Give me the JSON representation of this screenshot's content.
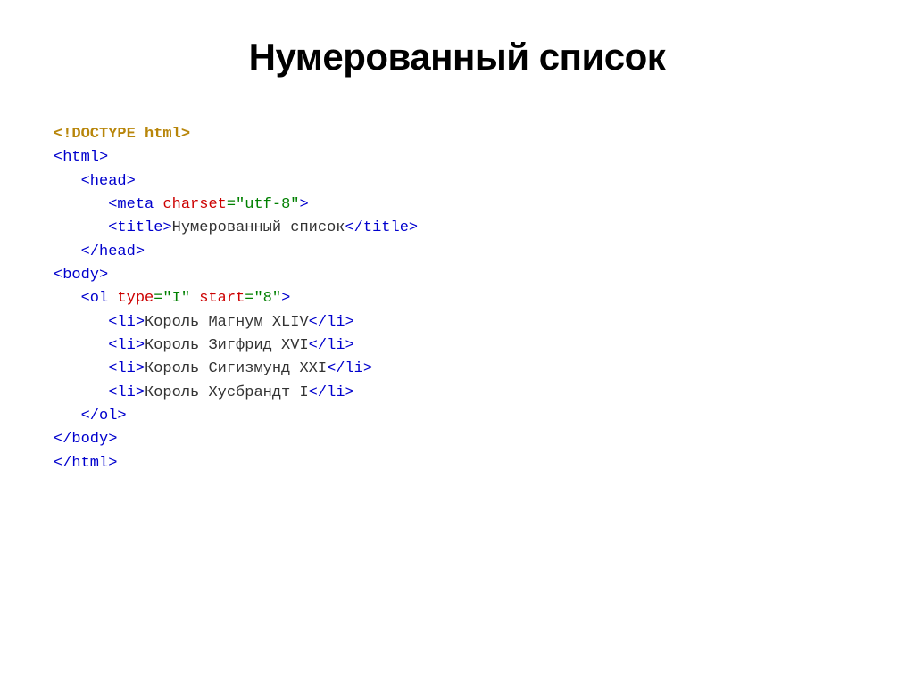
{
  "title": "Нумерованный список",
  "code": {
    "doctype": "<!DOCTYPE html>",
    "htmlOpen": "<html>",
    "headOpen": "<head>",
    "metaOpen": "<meta",
    "metaAttr": "charset",
    "metaVal": "=\"utf-8\"",
    "metaClose": ">",
    "titleOpen": "<title>",
    "titleText": "Нумерованный список",
    "titleClose": "</title>",
    "headClose": "</head>",
    "bodyOpen": "<body>",
    "olOpen": "<ol",
    "olAttr1": "type",
    "olVal1": "=\"I\"",
    "olAttr2": "start",
    "olVal2": "=\"8\"",
    "olClose": ">",
    "liOpen": "<li>",
    "liClose": "</li>",
    "li1": "Король Магнум XLIV",
    "li2": "Король Зигфрид XVI",
    "li3": "Король Сигизмунд XXI",
    "li4": "Король Хусбрандт I",
    "olEnd": "</ol>",
    "bodyClose": "</body>",
    "htmlClose": "</html>"
  }
}
